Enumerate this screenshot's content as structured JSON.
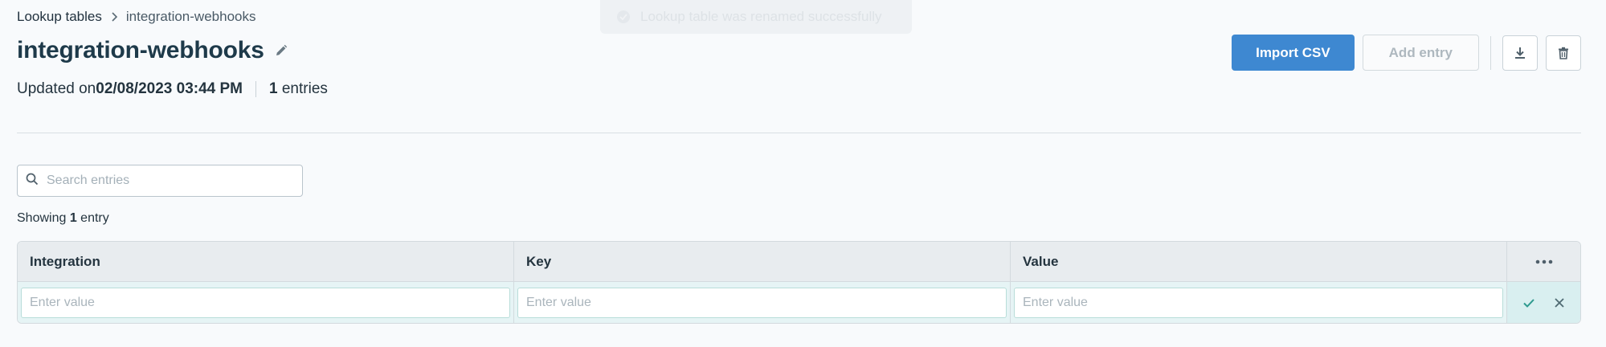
{
  "breadcrumb": {
    "parent": "Lookup tables",
    "current": "integration-webhooks"
  },
  "toast": {
    "text": "Lookup table was renamed successfully"
  },
  "header": {
    "title": "integration-webhooks",
    "updated_prefix": "Updated on ",
    "updated_value": "02/08/2023 03:44 PM",
    "entries_count": "1",
    "entries_suffix": " entries"
  },
  "actions": {
    "import_label": "Import CSV",
    "add_label": "Add entry"
  },
  "search": {
    "placeholder": "Search entries"
  },
  "summary": {
    "prefix": "Showing ",
    "count": "1",
    "suffix": " entry"
  },
  "table": {
    "columns": [
      "Integration",
      "Key",
      "Value"
    ],
    "row_placeholder": "Enter value"
  },
  "colors": {
    "primary": "#3e88d1",
    "row_highlight": "#e6f4f5",
    "accent_teal": "#2f9a8f"
  }
}
